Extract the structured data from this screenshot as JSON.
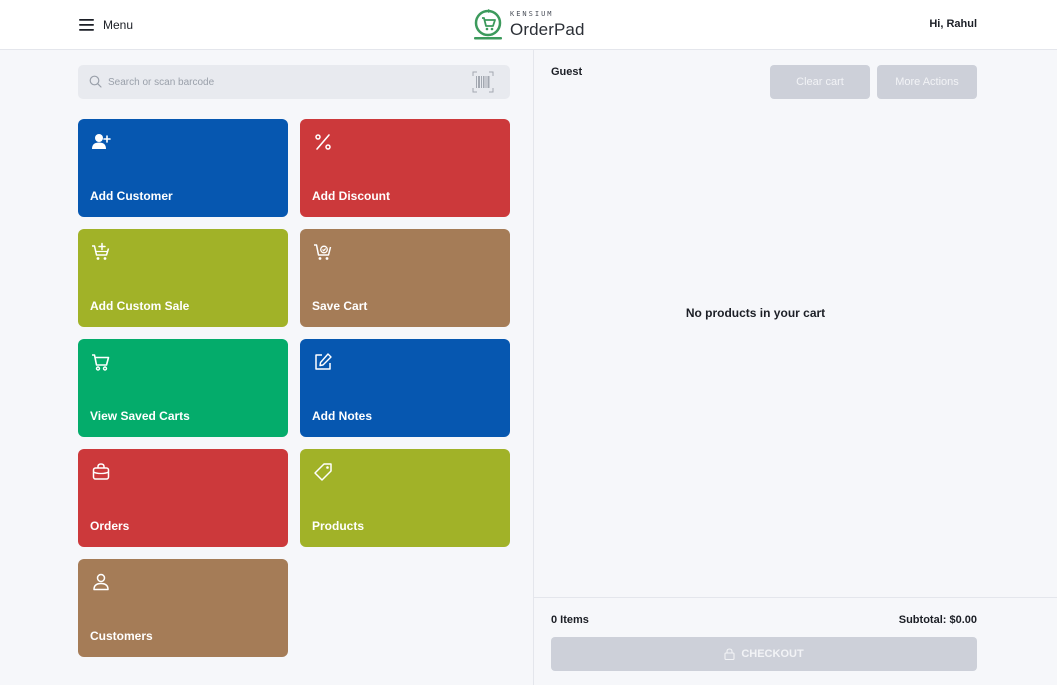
{
  "header": {
    "menu_label": "Menu",
    "logo_brand": "KENSIUM",
    "logo_name": "OrderPad",
    "greeting": "Hi, Rahul"
  },
  "search": {
    "placeholder": "Search or scan barcode",
    "value": ""
  },
  "tiles": [
    {
      "label": "Add Customer",
      "icon": "add-user-icon",
      "color": "#0657b0"
    },
    {
      "label": "Add Discount",
      "icon": "percent-icon",
      "color": "#cc393b"
    },
    {
      "label": "Add Custom Sale",
      "icon": "cart-plus-icon",
      "color": "#a1b228"
    },
    {
      "label": "Save Cart",
      "icon": "cart-save-icon",
      "color": "#a57c57"
    },
    {
      "label": "View Saved Carts",
      "icon": "cart-icon",
      "color": "#04ac6b"
    },
    {
      "label": "Add Notes",
      "icon": "edit-icon",
      "color": "#0657b0"
    },
    {
      "label": "Orders",
      "icon": "bag-icon",
      "color": "#cc393b"
    },
    {
      "label": "Products",
      "icon": "tag-icon",
      "color": "#a1b228"
    },
    {
      "label": "Customers",
      "icon": "user-icon",
      "color": "#a57c57"
    }
  ],
  "cart": {
    "customer": "Guest",
    "clear_label": "Clear cart",
    "more_label": "More Actions",
    "empty_message": "No products in your cart",
    "items_count": "0 Items",
    "subtotal": "Subtotal: $0.00",
    "checkout_label": "CHECKOUT"
  },
  "colors": {
    "logo_green": "#3c9a5c",
    "disabled_button": "#cdd0d9"
  }
}
